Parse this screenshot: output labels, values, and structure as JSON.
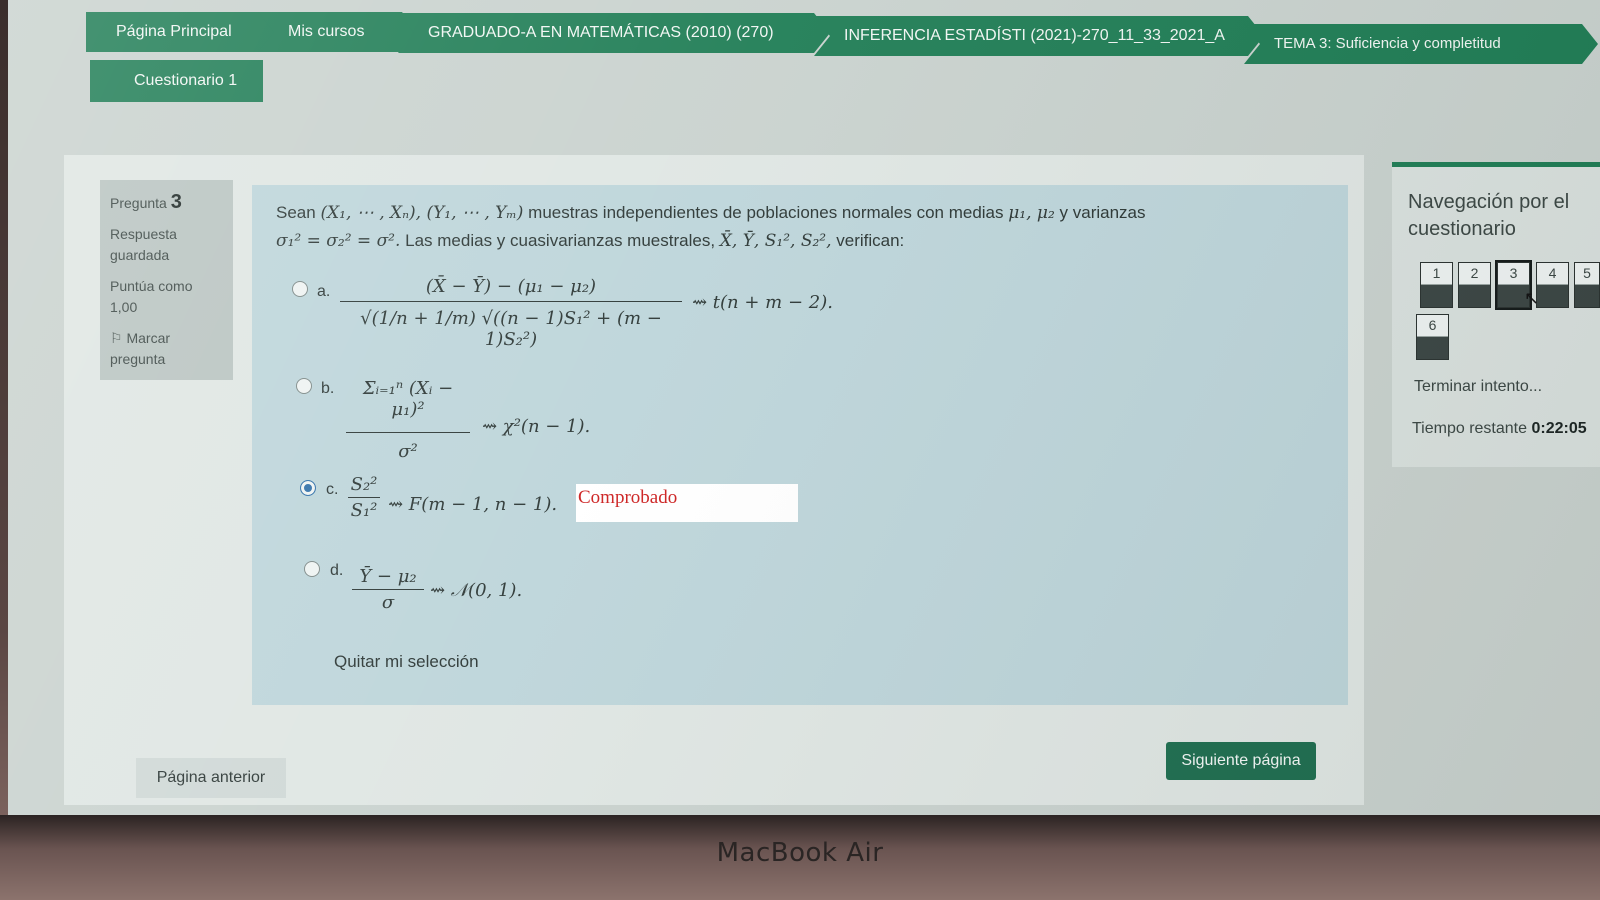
{
  "breadcrumb": {
    "items": [
      "Página Principal",
      "Mis cursos",
      "GRADUADO-A EN MATEMÁTICAS (2010) (270)",
      "INFERENCIA ESTADÍSTI (2021)-270_11_33_2021_A",
      "TEMA 3: Suficiencia y completitud"
    ],
    "current": "Cuestionario 1"
  },
  "question_info": {
    "label": "Pregunta",
    "number": "3",
    "status": "Respuesta guardada",
    "points": "Puntúa como 1,00",
    "flag": "Marcar pregunta"
  },
  "question": {
    "text_intro": "Sean",
    "samples": "(X₁, ⋯ , Xₙ), (Y₁, ⋯ , Yₘ)",
    "text_mid": "muestras independientes de poblaciones normales con medias",
    "means": "μ₁, μ₂",
    "text_var": "y varianzas",
    "variances": "σ₁² = σ₂² = σ².",
    "text_stats": "Las medias y cuasivarianzas muestrales,",
    "stats": "X̄, Ȳ, S₁², S₂²,",
    "text_end": "verifican:"
  },
  "options": [
    {
      "letter": "a.",
      "numerator": "(X̄ − Ȳ) − (μ₁ − μ₂)",
      "denominator": "√(1/n + 1/m) √((n − 1)S₁² + (m − 1)S₂²)",
      "rhs": "⇝ t(n + m − 2).",
      "selected": false
    },
    {
      "letter": "b.",
      "numerator": "Σᵢ₌₁ⁿ (Xᵢ − μ₁)²",
      "denominator": "σ²",
      "rhs": "⇝ χ²(n − 1).",
      "selected": false
    },
    {
      "letter": "c.",
      "numerator": "S₂²",
      "denominator": "S₁²",
      "rhs": "⇝ F(m − 1, n − 1).",
      "selected": true
    },
    {
      "letter": "d.",
      "numerator": "Ȳ − μ₂",
      "denominator": "σ",
      "rhs": "⇝ 𝒩(0, 1).",
      "selected": false
    }
  ],
  "stamp": "Comprobado",
  "clear_selection": "Quitar mi selección",
  "buttons": {
    "prev": "Página anterior",
    "next": "Siguiente página"
  },
  "navigation": {
    "title": "Navegación por el cuestionario",
    "questions": [
      "1",
      "2",
      "3",
      "4",
      "5",
      "6"
    ],
    "current": "3",
    "finish": "Terminar intento...",
    "timer_label": "Tiempo restante",
    "timer_value": "0:22:05"
  },
  "device_brand": "MacBook Air",
  "colors": {
    "brand_green": "#1f7d55",
    "stamp_red": "#cc1d1d",
    "radio_selected": "#2f6fa8"
  }
}
